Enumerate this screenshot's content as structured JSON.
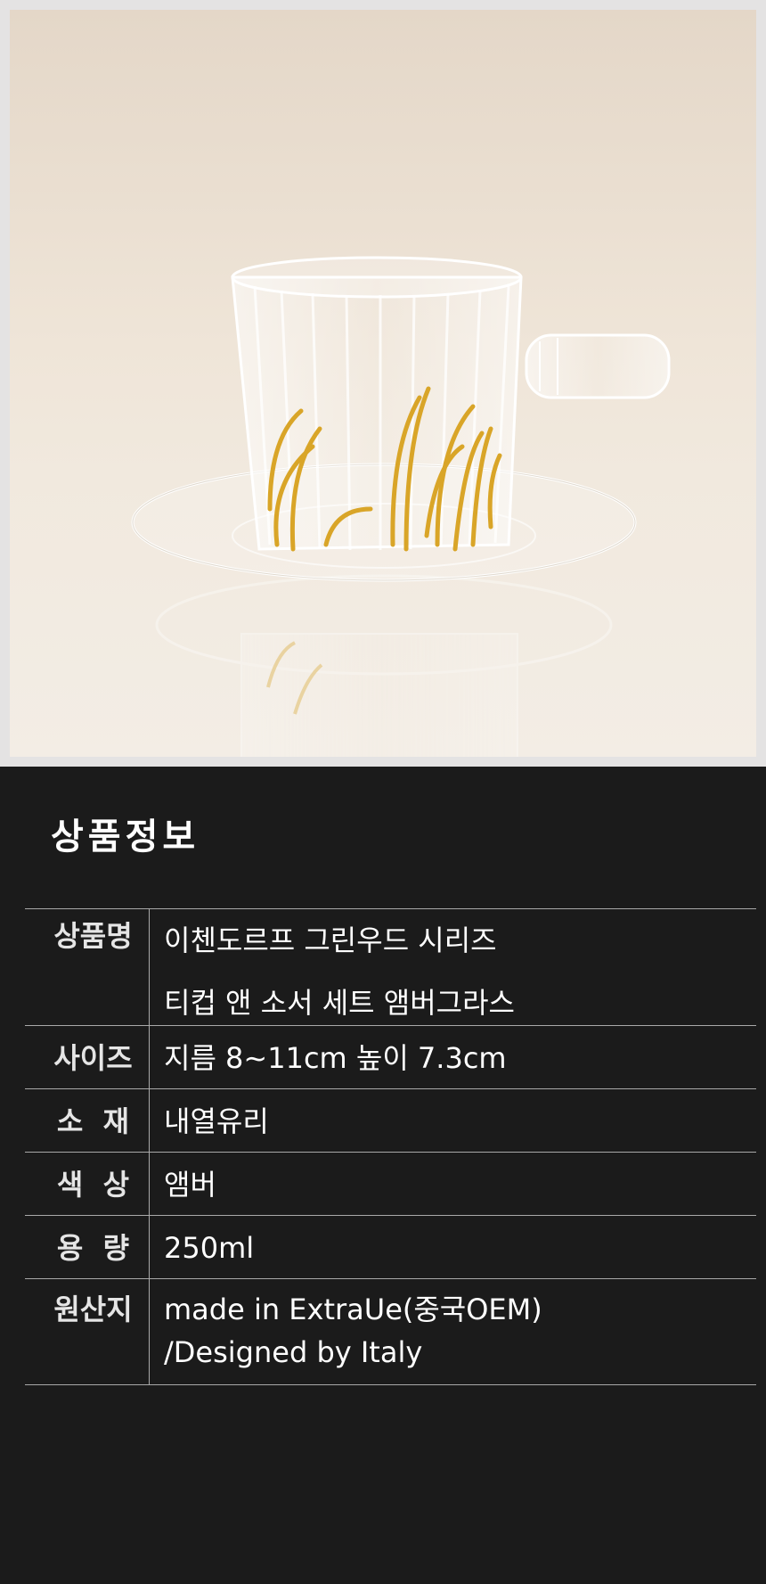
{
  "product_info": {
    "title": "상품정보",
    "rows": [
      {
        "label": "상품명",
        "value": [
          "이첸도르프 그린우드 시리즈",
          "티컵 앤 소서 세트 앰버그라스"
        ]
      },
      {
        "label": "사이즈",
        "value": [
          "지름 8~11cm 높이 7.3cm"
        ]
      },
      {
        "label": "소  재",
        "value": [
          "내열유리"
        ]
      },
      {
        "label": "색  상",
        "value": [
          "앰버"
        ]
      },
      {
        "label": "용  량",
        "value": [
          "250ml"
        ]
      },
      {
        "label": "원산지",
        "value": [
          "made in ExtraUe(중국OEM)",
          "/Designed by Italy"
        ]
      }
    ]
  },
  "colors": {
    "background": "#1b1b1b",
    "divider": "#a9a9a9",
    "amber": "#d9a528"
  }
}
